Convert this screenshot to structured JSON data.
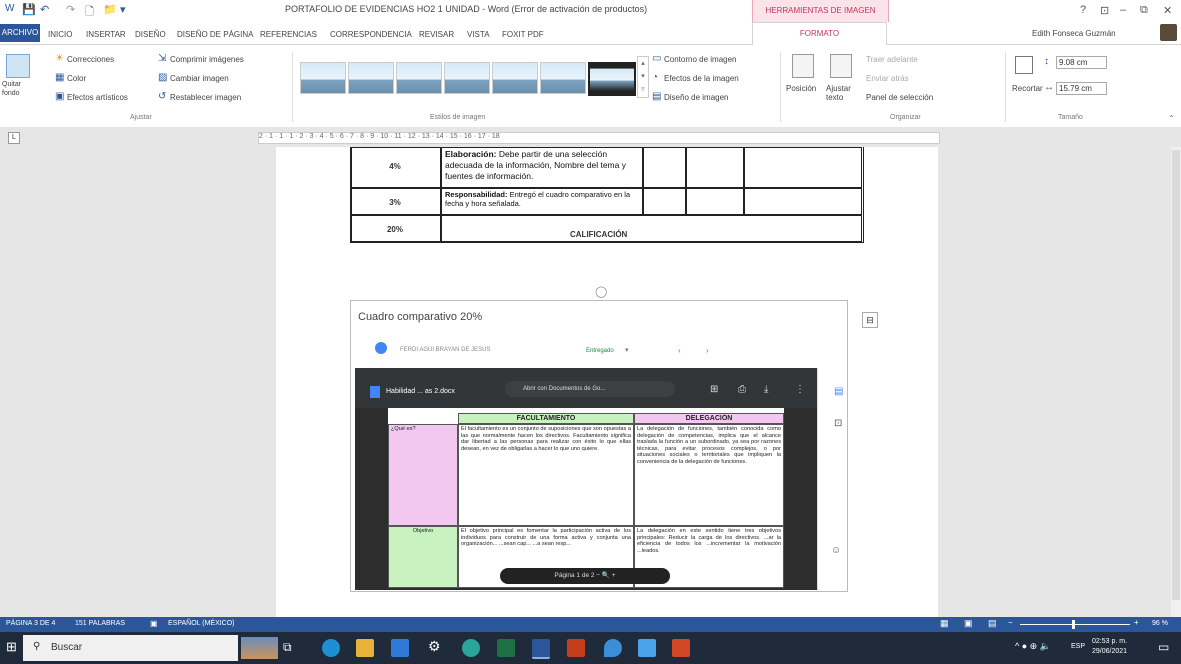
{
  "window": {
    "title": "PORTAFOLIO DE EVIDENCIAS HO2 1 UNIDAD - Word (Error de activación de productos)",
    "context_tab": "HERRAMIENTAS DE IMAGEN",
    "controls": [
      "?",
      "⊡",
      "–",
      "⧉",
      "✕"
    ]
  },
  "tabs": [
    "ARCHIVO",
    "INICIO",
    "INSERTAR",
    "DISEÑO",
    "DISEÑO DE PÁGINA",
    "REFERENCIAS",
    "CORRESPONDENCIA",
    "REVISAR",
    "VISTA",
    "FOXIT PDF",
    "FORMATO"
  ],
  "user": {
    "name": "Edith Fonseca Guzmán"
  },
  "ribbon": {
    "quitar_fondo": "Quitar fondo",
    "ajustar": {
      "correcciones": "Correcciones",
      "color": "Color",
      "efectos_artisticos": "Efectos artísticos",
      "comprimir": "Comprimir imágenes",
      "cambiar": "Cambiar imagen",
      "restablecer": "Restablecer imagen",
      "label": "Ajustar"
    },
    "estilos": {
      "label": "Estilos de imagen",
      "contorno": "Contorno de imagen",
      "efectos": "Efectos de la imagen",
      "diseno": "Diseño de imagen"
    },
    "organizar": {
      "label": "Organizar",
      "posicion": "Posición",
      "ajustar_texto": "Ajustar texto",
      "traer": "Traer adelante",
      "enviar": "Enviar atrás",
      "panel": "Panel de selección"
    },
    "tamano": {
      "label": "Tamaño",
      "recortar": "Recortar",
      "alto": "9.08 cm",
      "ancho": "15.79 cm"
    }
  },
  "ruler": "2 · 1 · 1 · 1 · 2 · 3 · 4 · 5 · 6 · 7 · 8 · 9 · 10 · 11 · 12 · 13 · 14 · 15 · 16 · 17 · 18",
  "rubric": [
    {
      "pct": "4%",
      "desc_bold": "Elaboración:",
      "desc": " Debe partir de una selección adecuada de la información, Nombre del tema y fuentes de información."
    },
    {
      "pct": "3%",
      "desc_bold": "Responsabilidad:",
      "desc": " Entregó el cuadro comparativo en la fecha y hora señalada."
    },
    {
      "pct": "20%",
      "desc_bold": "",
      "desc": "CALIFICACIÓN"
    }
  ],
  "image": {
    "title": "Cuadro comparativo 20%",
    "student": "FERDI AGUI BRAYAN DE JESUS",
    "status": "Entregado",
    "viewer_doc": "Habilidad ... as 2.docx",
    "viewer_open": "Abrir con Documentos de Go...",
    "pager": "Página  1  de  2     −   🔍  +",
    "table": {
      "col1": "FACULTAMIENTO",
      "col2": "DELEGACIÓN",
      "row1_label": "¿Qué es?",
      "row1_col1": "El facultamiento es un conjunto de suposiciones que son opuestas a las que normalmente hacen los directivos. Facultamiento significa dar libertad a las personas para realizar con éxito lo que ellas desean, en vez de obligarlas a hacer lo que uno quiere.",
      "row1_col2": "La delegación de funciones, también conocida como delegación de competencias, implica que el alcance traslada la función a un subordinado, ya sea por razones técnicas, para evitar procesos complejos, o por situaciones sociales o territoriales que impliquen la conveniencia de la delegación de funciones.",
      "row2_label": "Objetivo",
      "row2_col1": "El objetivo principal es fomentar la participación activa de los individuos para construir de una forma activa y conjunta una organización... ...sean cap... ...a sean resp...",
      "row2_col2": "La delegación en este sentido tiene tres objetivos principales: Reducir la carga de los directivos. ...ar la eficiencia de todos los ...incrementar la motivación ...leados."
    }
  },
  "statusbar": {
    "page": "PÁGINA 3 DE 4",
    "words": "151 PALABRAS",
    "lang": "ESPAÑOL (MÉXICO)",
    "zoom": "96 %"
  },
  "taskbar": {
    "search": "Buscar",
    "time": "02:53 p. m.",
    "date": "29/06/2021",
    "lang": "ESP"
  },
  "colors": {
    "word_blue": "#2b579a",
    "format_pink": "#c0365c",
    "facult_green": "#c8f2c0",
    "deleg_pink": "#f2c8f0"
  }
}
